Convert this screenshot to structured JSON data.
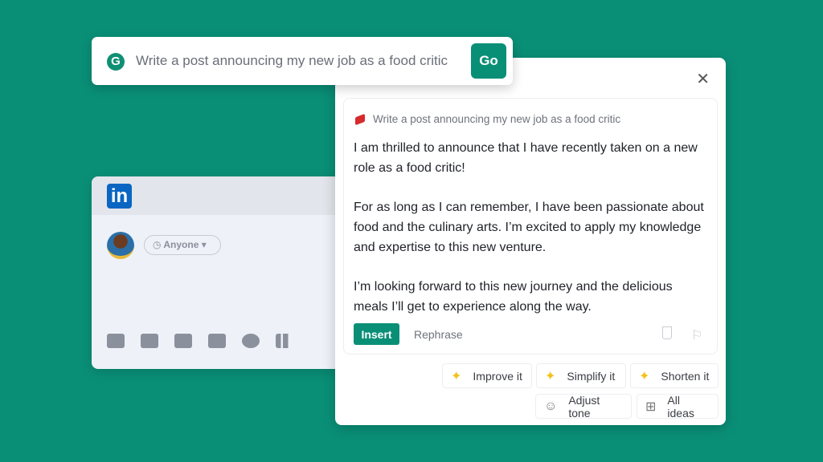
{
  "prompt_bar": {
    "text": "Write a post announcing my new job as a food critic",
    "go_label": "Go"
  },
  "linkedin": {
    "logo": "in",
    "audience": "Anyone"
  },
  "panel": {
    "prompt": "Write a post announcing my new job as a food critic",
    "paragraphs": [
      "I am thrilled to announce that I have recently taken on a new role as a food critic!",
      "For as long as I can remember, I have been passionate about food and the culinary arts. I’m excited to apply my knowledge and expertise to this new venture.",
      "I’m looking forward to this new journey and the delicious meals I’ll get to experience along the way."
    ],
    "insert_label": "Insert",
    "rephrase_label": "Rephrase",
    "chips": {
      "improve": "Improve it",
      "simplify": "Simplify it",
      "shorten": "Shorten it",
      "tone": "Adjust tone",
      "all": "All ideas"
    }
  },
  "colors": {
    "brand": "#0a8f77",
    "linkedin": "#0a66c2"
  }
}
